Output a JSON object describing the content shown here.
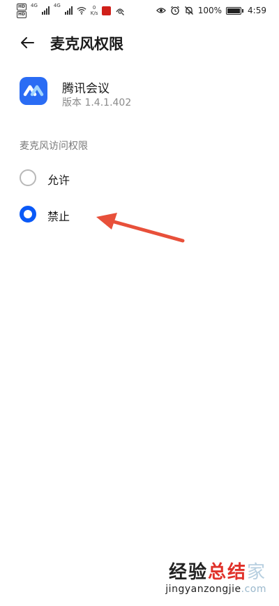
{
  "status_bar": {
    "hd_badges": [
      "HD",
      "HD"
    ],
    "net_labels": [
      "4G",
      "4G"
    ],
    "speed_value": "0",
    "speed_unit": "K/s",
    "battery_text": "100%",
    "time": "4:59",
    "icons": [
      "eye-icon",
      "alarm-icon",
      "mute-icon",
      "battery-icon"
    ]
  },
  "header": {
    "back_icon": "arrow-left-icon",
    "title": "麦克风权限"
  },
  "app": {
    "name": "腾讯会议",
    "version": "版本 1.4.1.402",
    "icon_color": "#2a6cf4"
  },
  "section": {
    "title": "麦克风访问权限"
  },
  "options": [
    {
      "label": "允许",
      "selected": false
    },
    {
      "label": "禁止",
      "selected": true
    }
  ],
  "annotation": {
    "arrow_color": "#e8503a",
    "points_to": "禁止"
  },
  "watermark": {
    "zh_part1": "经验",
    "zh_part2": "总结",
    "zh_part3": "家",
    "en_part1": "jingyanzongjie",
    "en_part2": ".com"
  },
  "colors": {
    "accent": "#0a59f7",
    "radio_off": "#b8b8b8"
  }
}
